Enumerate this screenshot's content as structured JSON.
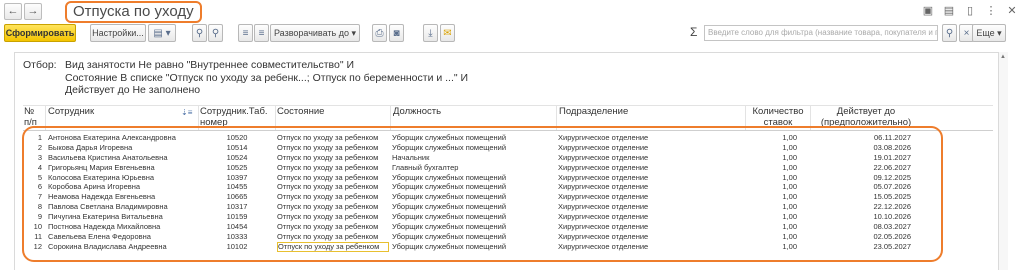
{
  "window": {
    "title": "Отпуска по уходу",
    "back_glyph": "←",
    "forward_glyph": "→"
  },
  "toolbar": {
    "generate_label": "Сформировать",
    "settings_label": "Настройки...",
    "expand_label": "Разворачивать до",
    "more_label": "Еще",
    "filter_placeholder": "Введите слово для фильтра (название товара, покупателя и пр.)",
    "sigma": "Σ"
  },
  "filters": {
    "label": "Отбор:",
    "lines": [
      "Вид занятости Не равно \"Внутреннее совместительство\" И",
      "Состояние В списке \"Отпуск по уходу за ребенк...; Отпуск по беременности и ...\" И",
      "Действует до Не заполнено"
    ]
  },
  "table": {
    "headers": {
      "num": "№\nп/п",
      "employee": "Сотрудник",
      "tab_number": "Сотрудник.Таб.\nномер",
      "state": "Состояние",
      "position": "Должность",
      "department": "Подразделение",
      "rate_count": "Количество\nставок",
      "valid_until": "Действует до\n(предположительно)"
    },
    "rows": [
      {
        "n": "1",
        "name": "Антонова Екатерина Александровна",
        "tab": "10520",
        "state": "Отпуск по уходу за ребенком",
        "position": "Уборщик служебных помещений",
        "dept": "Хирургическое отделение",
        "rate": "1,00",
        "until": "06.11.2027"
      },
      {
        "n": "2",
        "name": "Быкова Дарья Игоревна",
        "tab": "10514",
        "state": "Отпуск по уходу за ребенком",
        "position": "Уборщик служебных помещений",
        "dept": "Хирургическое отделение",
        "rate": "1,00",
        "until": "03.08.2026"
      },
      {
        "n": "3",
        "name": "Васильева Кристина Анатольевна",
        "tab": "10524",
        "state": "Отпуск по уходу за ребенком",
        "position": "Начальник",
        "dept": "Хирургическое отделение",
        "rate": "1,00",
        "until": "19.01.2027"
      },
      {
        "n": "4",
        "name": "Григорьянц Мария Евгеньевна",
        "tab": "10525",
        "state": "Отпуск по уходу за ребенком",
        "position": "Главный бухгалтер",
        "dept": "Хирургическое отделение",
        "rate": "1,00",
        "until": "22.06.2027"
      },
      {
        "n": "5",
        "name": "Колосова Екатерина Юрьевна",
        "tab": "10397",
        "state": "Отпуск по уходу за ребенком",
        "position": "Уборщик служебных помещений",
        "dept": "Хирургическое отделение",
        "rate": "1,00",
        "until": "09.12.2025"
      },
      {
        "n": "6",
        "name": "Коробова Арина Игоревна",
        "tab": "10455",
        "state": "Отпуск по уходу за ребенком",
        "position": "Уборщик служебных помещений",
        "dept": "Хирургическое отделение",
        "rate": "1,00",
        "until": "05.07.2026"
      },
      {
        "n": "7",
        "name": "Неамова Надежда Евгеньевна",
        "tab": "10665",
        "state": "Отпуск по уходу за ребенком",
        "position": "Уборщик служебных помещений",
        "dept": "Хирургическое отделение",
        "rate": "1,00",
        "until": "15.05.2025"
      },
      {
        "n": "8",
        "name": "Павлова Светлана Владимировна",
        "tab": "10317",
        "state": "Отпуск по уходу за ребенком",
        "position": "Уборщик служебных помещений",
        "dept": "Хирургическое отделение",
        "rate": "1,00",
        "until": "22.12.2026"
      },
      {
        "n": "9",
        "name": "Пичугина Екатерина Витальевна",
        "tab": "10159",
        "state": "Отпуск по уходу за ребенком",
        "position": "Уборщик служебных помещений",
        "dept": "Хирургическое отделение",
        "rate": "1,00",
        "until": "10.10.2026"
      },
      {
        "n": "10",
        "name": "Постнова Надежда Михайловна",
        "tab": "10454",
        "state": "Отпуск по уходу за ребенком",
        "position": "Уборщик служебных помещений",
        "dept": "Хирургическое отделение",
        "rate": "1,00",
        "until": "08.03.2027"
      },
      {
        "n": "11",
        "name": "Савельева Елена Федоровна",
        "tab": "10333",
        "state": "Отпуск по уходу за ребенком",
        "position": "Уборщик служебных помещений",
        "dept": "Хирургическое отделение",
        "rate": "1,00",
        "until": "02.05.2026"
      },
      {
        "n": "12",
        "name": "Сорокина Владислава Андреевна",
        "tab": "10102",
        "state": "Отпуск по уходу за ребенком",
        "position": "Уборщик служебных помещений",
        "dept": "Хирургическое отделение",
        "rate": "1,00",
        "until": "23.05.2027"
      }
    ]
  }
}
